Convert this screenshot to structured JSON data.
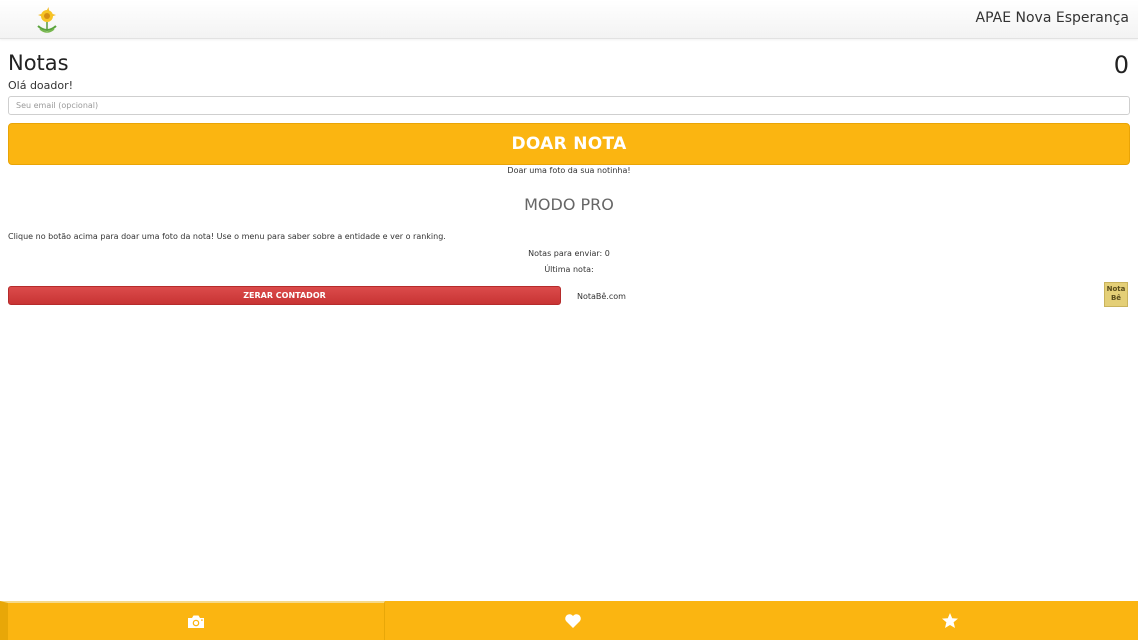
{
  "header": {
    "app_title": "APAE Nova Esperança",
    "logo_icon": "sunflower-logo-icon"
  },
  "main": {
    "page_title": "Notas",
    "counter": "0",
    "greeting": "Olá doador!",
    "email_placeholder": "Seu email (opcional)",
    "donate_label": "DOAR NOTA",
    "donate_hint": "Doar uma foto da sua notinha!",
    "pro_mode_label": "MODO PRO",
    "instructions": "Clique no botão acima para doar uma foto da nota! Use o menu para saber sobre a entidade e ver o ranking.",
    "pending_label": "Notas para enviar: 0",
    "last_note_label": "Última nota:",
    "reset_label": "ZERAR CONTADOR",
    "notabe_link": "NotaBê.com",
    "notabe_logo_text": "Nota Bê"
  },
  "tabs": [
    {
      "icon": "camera-icon",
      "active": true
    },
    {
      "icon": "heart-icon",
      "active": false
    },
    {
      "icon": "star-icon",
      "active": false
    }
  ],
  "colors": {
    "accent": "#fbb511",
    "danger": "#c83434",
    "background": "#ffffff"
  }
}
